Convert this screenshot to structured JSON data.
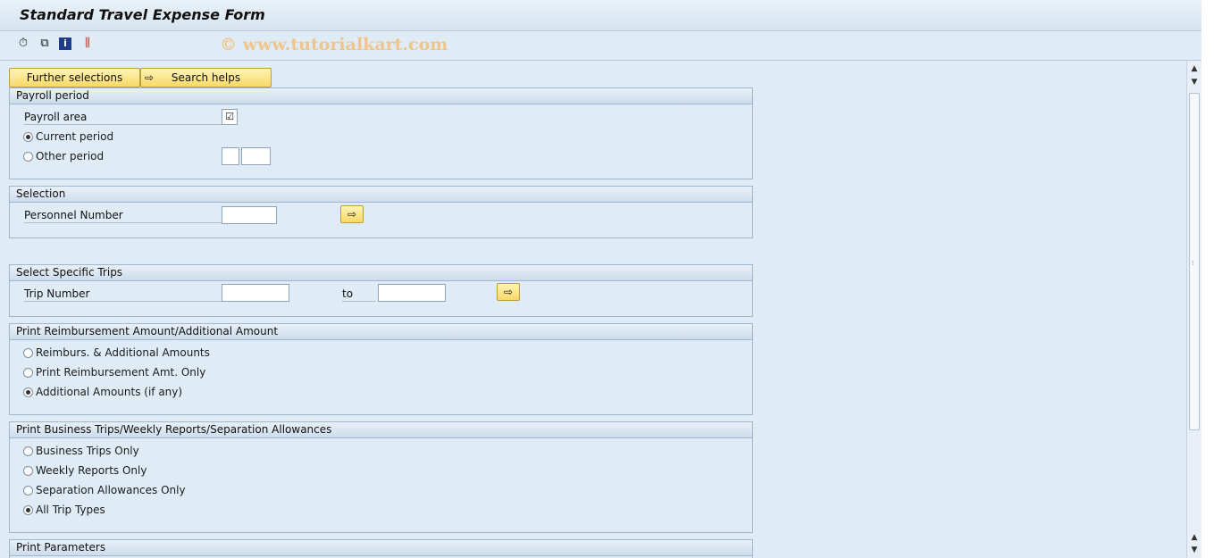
{
  "window": {
    "title": "Standard Travel Expense Form"
  },
  "toolbar": {
    "icons": [
      "execute-icon",
      "save-variant-icon",
      "info-icon",
      "selection-options-icon"
    ],
    "glyphs": [
      "⏱",
      "⧉",
      "i",
      "⫼"
    ],
    "watermark": "© www.tutorialkart.com"
  },
  "buttons": {
    "further_selections": "Further selections",
    "search_helps": "Search helps"
  },
  "payroll_period": {
    "header": "Payroll period",
    "payroll_area_label": "Payroll area",
    "payroll_area_checked": "☑",
    "current_period": "Current period",
    "other_period": "Other period",
    "current_selected": true
  },
  "selection": {
    "header": "Selection",
    "personnel_number_label": "Personnel Number"
  },
  "specific_trips": {
    "header": "Select Specific Trips",
    "trip_number_label": "Trip Number",
    "to_label": "to"
  },
  "reimbursement": {
    "header": "Print Reimbursement Amount/Additional Amount",
    "options": [
      "Reimburs. & Additional Amounts",
      "Print Reimbursement Amt. Only",
      "Additional Amounts (if any)"
    ],
    "selected_index": 2
  },
  "business_trips": {
    "header": "Print Business Trips/Weekly Reports/Separation Allowances",
    "options": [
      "Business Trips Only",
      "Weekly Reports Only",
      "Separation Allowances Only",
      "All Trip Types"
    ],
    "selected_index": 3
  },
  "print_parameters": {
    "header": "Print Parameters"
  },
  "colors": {
    "background": "#dfebf5",
    "button_yellow": "#f7d966",
    "watermark": "#f0c58c"
  }
}
